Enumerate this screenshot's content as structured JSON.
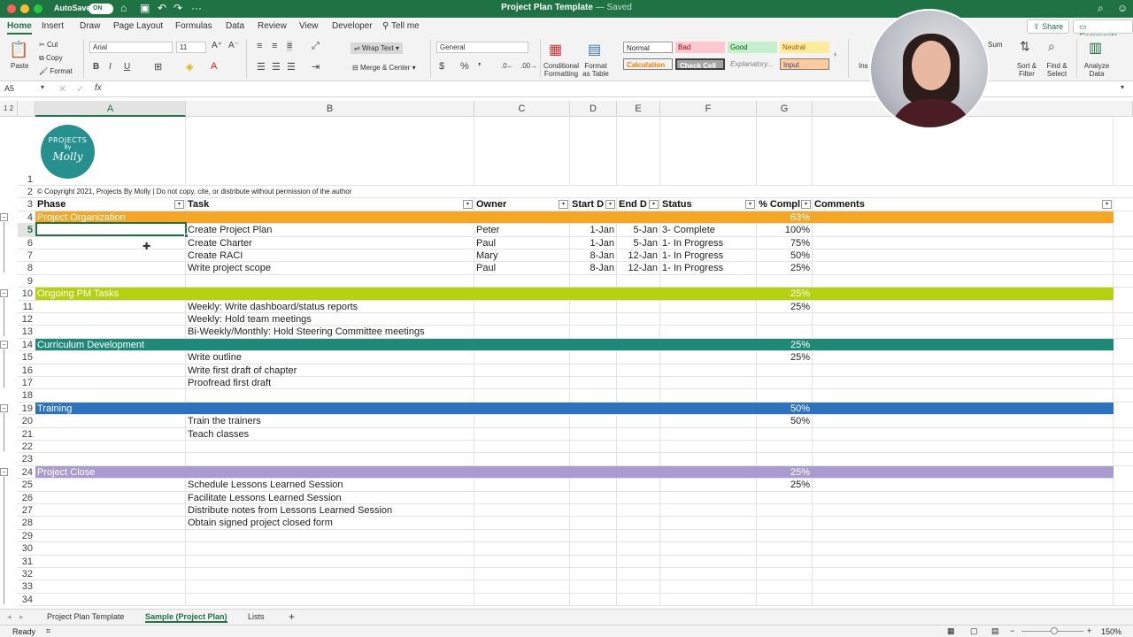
{
  "window": {
    "title": "Project Plan Template",
    "saved": "— Saved",
    "autosave_label": "AutoSave",
    "autosave_state": "ON"
  },
  "ribbon_tabs": [
    "Home",
    "Insert",
    "Draw",
    "Page Layout",
    "Formulas",
    "Data",
    "Review",
    "View",
    "Developer"
  ],
  "tell_me": "Tell me",
  "share_label": "Share",
  "comments_label": "Comments",
  "ribbon": {
    "paste": "Paste",
    "cut": "Cut",
    "copy": "Copy",
    "format": "Format",
    "font_name": "Arial",
    "font_size": "11",
    "wrap_text": "Wrap Text",
    "merge_center": "Merge & Center",
    "number_format": "General",
    "conditional_formatting": "Conditional Formatting",
    "format_as_table": "Format as Table",
    "styles": {
      "normal": "Normal",
      "bad": "Bad",
      "good": "Good",
      "neutral": "Neutral",
      "calculation": "Calculation",
      "check_cell": "Check Cell",
      "explanatory": "Explanatory...",
      "input": "Input"
    },
    "insert": "Ins",
    "sum": "Sum",
    "sort_filter": "Sort & Filter",
    "find_select": "Find & Select",
    "analyze_data": "Analyze Data"
  },
  "formula_bar": {
    "name_box": "A5",
    "fx": "fx"
  },
  "columns": [
    "A",
    "B",
    "C",
    "D",
    "E",
    "F",
    "G"
  ],
  "logo": {
    "line1": "PROJECTS",
    "line2": "By",
    "line3": "Molly"
  },
  "copyright": "© Copyright 2021, Projects By Molly | Do not copy, cite, or distribute without permission of the author",
  "header": {
    "phase": "Phase",
    "task": "Task",
    "owner": "Owner",
    "start": "Start D",
    "end": "End D",
    "status": "Status",
    "pct": "% Compl",
    "comments": "Comments"
  },
  "rows": [
    {
      "n": "1"
    },
    {
      "n": "2"
    },
    {
      "n": "3"
    },
    {
      "n": "4",
      "phase": "Project Organization",
      "pct": "63%",
      "color": "#f6a623"
    },
    {
      "n": "5",
      "task": "Create Project Plan",
      "owner": "Peter",
      "start": "1-Jan",
      "end": "5-Jan",
      "status": "3- Complete",
      "pct": "100%"
    },
    {
      "n": "6",
      "task": "Create Charter",
      "owner": "Paul",
      "start": "1-Jan",
      "end": "5-Jan",
      "status": "1- In Progress",
      "pct": "75%"
    },
    {
      "n": "7",
      "task": "Create RACI",
      "owner": "Mary",
      "start": "8-Jan",
      "end": "12-Jan",
      "status": "1- In Progress",
      "pct": "50%"
    },
    {
      "n": "8",
      "task": "Write project scope",
      "owner": "Paul",
      "start": "8-Jan",
      "end": "12-Jan",
      "status": "1- In Progress",
      "pct": "25%"
    },
    {
      "n": "9"
    },
    {
      "n": "10",
      "phase": "Ongoing PM Tasks",
      "pct": "25%",
      "color": "#b5d20e"
    },
    {
      "n": "11",
      "task": "Weekly: Write dashboard/status reports",
      "pct": "25%"
    },
    {
      "n": "12",
      "task": "Weekly: Hold team meetings"
    },
    {
      "n": "13",
      "task": "Bi-Weekly/Monthly: Hold Steering Committee meetings"
    },
    {
      "n": "14",
      "phase": "Curriculum Development",
      "pct": "25%",
      "color": "#1d8a77"
    },
    {
      "n": "15",
      "task": "Write outline",
      "pct": "25%"
    },
    {
      "n": "16",
      "task": "Write first draft of chapter"
    },
    {
      "n": "17",
      "task": "Proofread first draft"
    },
    {
      "n": "18"
    },
    {
      "n": "19",
      "phase": "Training",
      "pct": "50%",
      "color": "#2c73bf"
    },
    {
      "n": "20",
      "task": "Train the trainers",
      "pct": "50%"
    },
    {
      "n": "21",
      "task": "Teach classes"
    },
    {
      "n": "22"
    },
    {
      "n": "23"
    },
    {
      "n": "24",
      "phase": "Project Close",
      "pct": "25%",
      "color": "#a99bd1"
    },
    {
      "n": "25",
      "task": "Schedule Lessons Learned Session",
      "pct": "25%"
    },
    {
      "n": "26",
      "task": "Facilitate Lessons Learned Session"
    },
    {
      "n": "27",
      "task": "Distribute notes from Lessons Learned Session"
    },
    {
      "n": "28",
      "task": "Obtain signed project closed form"
    },
    {
      "n": "29"
    },
    {
      "n": "30"
    },
    {
      "n": "31"
    },
    {
      "n": "32"
    },
    {
      "n": "33"
    },
    {
      "n": "34"
    }
  ],
  "sheet_tabs": [
    "Project Plan Template",
    "Sample (Project Plan)",
    "Lists"
  ],
  "active_sheet": "Sample (Project Plan)",
  "status": {
    "ready": "Ready",
    "zoom": "150%"
  },
  "colors": {
    "excel_green": "#1f7244"
  }
}
